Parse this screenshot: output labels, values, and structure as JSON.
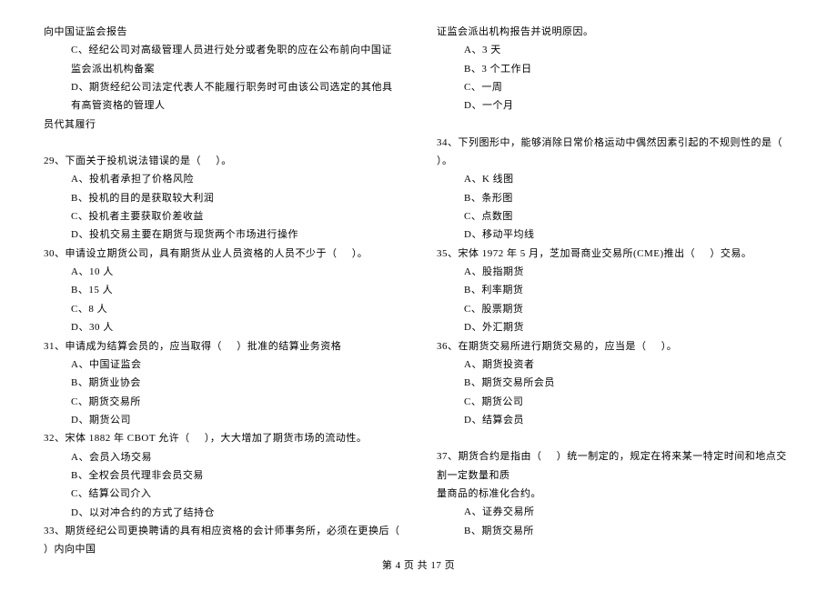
{
  "left": [
    {
      "cls": "indent-0",
      "text": "向中国证监会报告"
    },
    {
      "cls": "indent-1",
      "text": "C、经纪公司对高级管理人员进行处分或者免职的应在公布前向中国证监会派出机构备案"
    },
    {
      "cls": "indent-1",
      "text": "D、期货经纪公司法定代表人不能履行职务时可由该公司选定的其他具有高管资格的管理人"
    },
    {
      "cls": "indent-0",
      "text": "员代其履行"
    },
    {
      "cls": "blank",
      "text": ""
    },
    {
      "cls": "indent-0",
      "text": "29、下面关于投机说法错误的是（     ）。"
    },
    {
      "cls": "indent-1",
      "text": "A、投机者承担了价格风险"
    },
    {
      "cls": "indent-1",
      "text": "B、投机的目的是获取较大利润"
    },
    {
      "cls": "indent-1",
      "text": "C、投机者主要获取价差收益"
    },
    {
      "cls": "indent-1",
      "text": "D、投机交易主要在期货与现货两个市场进行操作"
    },
    {
      "cls": "indent-0",
      "text": "30、申请设立期货公司，具有期货从业人员资格的人员不少于（     ）。"
    },
    {
      "cls": "indent-1",
      "text": "A、10 人"
    },
    {
      "cls": "indent-1",
      "text": "B、15 人"
    },
    {
      "cls": "indent-1",
      "text": "C、8 人"
    },
    {
      "cls": "indent-1",
      "text": "D、30 人"
    },
    {
      "cls": "indent-0",
      "text": "31、申请成为结算会员的，应当取得（     ）批准的结算业务资格"
    },
    {
      "cls": "indent-1",
      "text": "A、中国证监会"
    },
    {
      "cls": "indent-1",
      "text": "B、期货业协会"
    },
    {
      "cls": "indent-1",
      "text": "C、期货交易所"
    },
    {
      "cls": "indent-1",
      "text": "D、期货公司"
    },
    {
      "cls": "indent-0",
      "text": "32、宋体 1882 年 CBOT 允许（     ），大大增加了期货市场的流动性。"
    },
    {
      "cls": "indent-1",
      "text": "A、会员入场交易"
    },
    {
      "cls": "indent-1",
      "text": "B、全权会员代理非会员交易"
    },
    {
      "cls": "indent-1",
      "text": "C、结算公司介入"
    },
    {
      "cls": "indent-1",
      "text": "D、以对冲合约的方式了结持仓"
    },
    {
      "cls": "indent-0",
      "text": "33、期货经纪公司更换聘请的具有相应资格的会计师事务所，必须在更换后（     ）内向中国"
    }
  ],
  "right": [
    {
      "cls": "indent-0",
      "text": "证监会派出机构报告并说明原因。"
    },
    {
      "cls": "indent-1",
      "text": "A、3 天"
    },
    {
      "cls": "indent-1",
      "text": "B、3 个工作日"
    },
    {
      "cls": "indent-1",
      "text": "C、一周"
    },
    {
      "cls": "indent-1",
      "text": "D、一个月"
    },
    {
      "cls": "blank",
      "text": ""
    },
    {
      "cls": "indent-0",
      "text": "34、下列图形中，能够消除日常价格运动中偶然因素引起的不规则性的是（     ）。"
    },
    {
      "cls": "indent-1",
      "text": "A、K 线图"
    },
    {
      "cls": "indent-1",
      "text": "B、条形图"
    },
    {
      "cls": "indent-1",
      "text": "C、点数图"
    },
    {
      "cls": "indent-1",
      "text": "D、移动平均线"
    },
    {
      "cls": "indent-0",
      "text": "35、宋体 1972 年 5 月，芝加哥商业交易所(CME)推出（     ）交易。"
    },
    {
      "cls": "indent-1",
      "text": "A、股指期货"
    },
    {
      "cls": "indent-1",
      "text": "B、利率期货"
    },
    {
      "cls": "indent-1",
      "text": "C、股票期货"
    },
    {
      "cls": "indent-1",
      "text": "D、外汇期货"
    },
    {
      "cls": "indent-0",
      "text": "36、在期货交易所进行期货交易的，应当是（     ）。"
    },
    {
      "cls": "indent-1",
      "text": "A、期货投资者"
    },
    {
      "cls": "indent-1",
      "text": "B、期货交易所会员"
    },
    {
      "cls": "indent-1",
      "text": "C、期货公司"
    },
    {
      "cls": "indent-1",
      "text": "D、结算会员"
    },
    {
      "cls": "blank",
      "text": ""
    },
    {
      "cls": "indent-0",
      "text": "37、期货合约是指由（     ）统一制定的，规定在将来某一特定时间和地点交割一定数量和质"
    },
    {
      "cls": "indent-0",
      "text": "量商品的标准化合约。"
    },
    {
      "cls": "indent-1",
      "text": "A、证券交易所"
    },
    {
      "cls": "indent-1",
      "text": "B、期货交易所"
    }
  ],
  "footer": "第 4 页  共 17 页"
}
